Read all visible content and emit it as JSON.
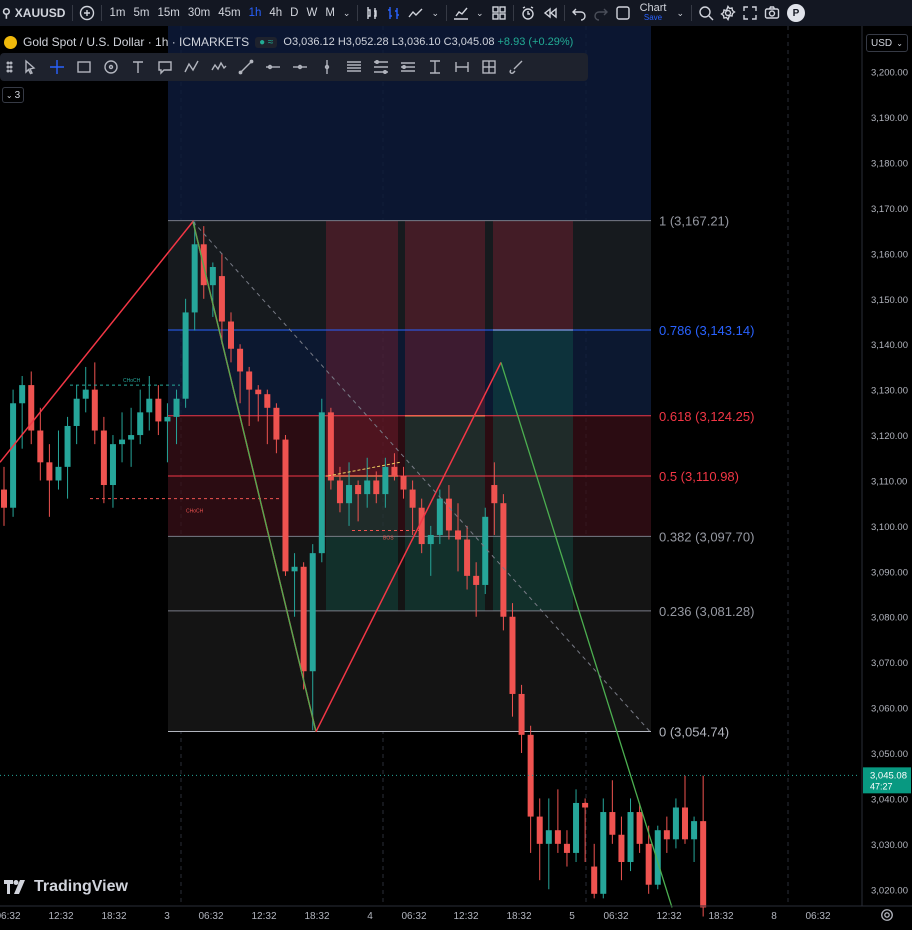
{
  "header": {
    "symbol": "XAUUSD",
    "timeframes": [
      "1m",
      "5m",
      "15m",
      "30m",
      "45m",
      "1h",
      "4h",
      "D",
      "W",
      "M"
    ],
    "active_timeframe": "1h",
    "chart_label": "Chart",
    "save_label": "Save",
    "avatar_letter": "P"
  },
  "legend": {
    "title": "Gold Spot / U.S. Dollar · 1h · ICMARKETS",
    "dots": "≈",
    "open": "O3,036.12",
    "high": "H3,052.28",
    "low": "L3,036.10",
    "close": "C3,045.08",
    "change": "+8.93 (+0.29%)"
  },
  "indicator_count": "3",
  "currency": "USD",
  "brand": "TradingView",
  "colors": {
    "up": "#26a69a",
    "down": "#ef5350",
    "background": "#000000",
    "fib_blue": "#2962ff",
    "fib_red": "#f23645"
  },
  "chart_data": {
    "type": "line",
    "y_axis": {
      "ticks": [
        "3,020.00",
        "3,030.00",
        "3,040.00",
        "3,050.00",
        "3,060.00",
        "3,070.00",
        "3,080.00",
        "3,090.00",
        "3,100.00",
        "3,110.00",
        "3,120.00",
        "3,130.00",
        "3,140.00",
        "3,150.00",
        "3,160.00",
        "3,170.00",
        "3,180.00",
        "3,190.00",
        "3,200.00"
      ],
      "range": [
        3016,
        3210
      ]
    },
    "x_axis": {
      "ticks": [
        "06:32",
        "12:32",
        "18:32",
        "3",
        "06:32",
        "12:32",
        "18:32",
        "4",
        "06:32",
        "12:32",
        "18:32",
        "5",
        "06:32",
        "12:32",
        "18:32",
        "8",
        "06:32"
      ]
    },
    "last_price": {
      "value": "3,045.08",
      "countdown": "47:27"
    },
    "fib_levels": [
      {
        "ratio": "1",
        "price": "3,167.21",
        "label": "1 (3,167.21)"
      },
      {
        "ratio": "0.786",
        "price": "3,143.14",
        "label": "0.786 (3,143.14)"
      },
      {
        "ratio": "0.618",
        "price": "3,124.25",
        "label": "0.618 (3,124.25)"
      },
      {
        "ratio": "0.5",
        "price": "3,110.98",
        "label": "0.5 (3,110.98)"
      },
      {
        "ratio": "0.382",
        "price": "3,097.70",
        "label": "0.382 (3,097.70)"
      },
      {
        "ratio": "0.236",
        "price": "3,081.28",
        "label": "0.236 (3,081.28)"
      },
      {
        "ratio": "0",
        "price": "3,054.74",
        "label": "0 (3,054.74)"
      }
    ],
    "annotations": [
      "CHoCH",
      "CHoCH",
      "BOS"
    ],
    "candles": [
      {
        "o": 3108,
        "h": 3113,
        "l": 3100,
        "c": 3104
      },
      {
        "o": 3104,
        "h": 3130,
        "l": 3102,
        "c": 3127
      },
      {
        "o": 3127,
        "h": 3133,
        "l": 3117,
        "c": 3131
      },
      {
        "o": 3131,
        "h": 3134,
        "l": 3118,
        "c": 3121
      },
      {
        "o": 3121,
        "h": 3126,
        "l": 3110,
        "c": 3114
      },
      {
        "o": 3114,
        "h": 3118,
        "l": 3102,
        "c": 3110
      },
      {
        "o": 3110,
        "h": 3121,
        "l": 3108,
        "c": 3113
      },
      {
        "o": 3113,
        "h": 3124,
        "l": 3106,
        "c": 3122
      },
      {
        "o": 3122,
        "h": 3131,
        "l": 3118,
        "c": 3128
      },
      {
        "o": 3128,
        "h": 3135,
        "l": 3125,
        "c": 3130
      },
      {
        "o": 3130,
        "h": 3136,
        "l": 3118,
        "c": 3121
      },
      {
        "o": 3121,
        "h": 3124,
        "l": 3105,
        "c": 3109
      },
      {
        "o": 3109,
        "h": 3120,
        "l": 3104,
        "c": 3118
      },
      {
        "o": 3118,
        "h": 3125,
        "l": 3114,
        "c": 3119
      },
      {
        "o": 3119,
        "h": 3126,
        "l": 3113,
        "c": 3120
      },
      {
        "o": 3120,
        "h": 3130,
        "l": 3118,
        "c": 3125
      },
      {
        "o": 3125,
        "h": 3133,
        "l": 3121,
        "c": 3128
      },
      {
        "o": 3128,
        "h": 3131,
        "l": 3120,
        "c": 3123
      },
      {
        "o": 3123,
        "h": 3127,
        "l": 3114,
        "c": 3124
      },
      {
        "o": 3124,
        "h": 3130,
        "l": 3118,
        "c": 3128
      },
      {
        "o": 3128,
        "h": 3150,
        "l": 3126,
        "c": 3147
      },
      {
        "o": 3147,
        "h": 3167,
        "l": 3143,
        "c": 3162
      },
      {
        "o": 3162,
        "h": 3166,
        "l": 3150,
        "c": 3153
      },
      {
        "o": 3153,
        "h": 3158,
        "l": 3146,
        "c": 3157
      },
      {
        "o": 3155,
        "h": 3160,
        "l": 3140,
        "c": 3145
      },
      {
        "o": 3145,
        "h": 3147,
        "l": 3136,
        "c": 3139
      },
      {
        "o": 3139,
        "h": 3140,
        "l": 3127,
        "c": 3134
      },
      {
        "o": 3134,
        "h": 3135,
        "l": 3122,
        "c": 3130
      },
      {
        "o": 3130,
        "h": 3131,
        "l": 3123,
        "c": 3129
      },
      {
        "o": 3129,
        "h": 3130,
        "l": 3118,
        "c": 3126
      },
      {
        "o": 3126,
        "h": 3127,
        "l": 3116,
        "c": 3119
      },
      {
        "o": 3119,
        "h": 3120,
        "l": 3089,
        "c": 3090
      },
      {
        "o": 3090,
        "h": 3094,
        "l": 3080,
        "c": 3091
      },
      {
        "o": 3091,
        "h": 3092,
        "l": 3064,
        "c": 3068
      },
      {
        "o": 3068,
        "h": 3096,
        "l": 3055,
        "c": 3094
      },
      {
        "o": 3094,
        "h": 3128,
        "l": 3092,
        "c": 3125
      },
      {
        "o": 3125,
        "h": 3126,
        "l": 3108,
        "c": 3110
      },
      {
        "o": 3110,
        "h": 3113,
        "l": 3103,
        "c": 3105
      },
      {
        "o": 3105,
        "h": 3114,
        "l": 3100,
        "c": 3109
      },
      {
        "o": 3109,
        "h": 3110,
        "l": 3101,
        "c": 3107
      },
      {
        "o": 3107,
        "h": 3115,
        "l": 3104,
        "c": 3110
      },
      {
        "o": 3110,
        "h": 3112,
        "l": 3105,
        "c": 3107
      },
      {
        "o": 3107,
        "h": 3115,
        "l": 3104,
        "c": 3113
      },
      {
        "o": 3113,
        "h": 3116,
        "l": 3110,
        "c": 3111
      },
      {
        "o": 3111,
        "h": 3113,
        "l": 3106,
        "c": 3108
      },
      {
        "o": 3108,
        "h": 3110,
        "l": 3098,
        "c": 3104
      },
      {
        "o": 3104,
        "h": 3106,
        "l": 3094,
        "c": 3096
      },
      {
        "o": 3096,
        "h": 3100,
        "l": 3089,
        "c": 3098
      },
      {
        "o": 3098,
        "h": 3108,
        "l": 3096,
        "c": 3106
      },
      {
        "o": 3106,
        "h": 3109,
        "l": 3097,
        "c": 3099
      },
      {
        "o": 3099,
        "h": 3105,
        "l": 3090,
        "c": 3097
      },
      {
        "o": 3097,
        "h": 3100,
        "l": 3086,
        "c": 3089
      },
      {
        "o": 3089,
        "h": 3092,
        "l": 3080,
        "c": 3087
      },
      {
        "o": 3087,
        "h": 3104,
        "l": 3085,
        "c": 3102
      },
      {
        "o": 3109,
        "h": 3114,
        "l": 3098,
        "c": 3105
      },
      {
        "o": 3105,
        "h": 3107,
        "l": 3077,
        "c": 3080
      },
      {
        "o": 3080,
        "h": 3083,
        "l": 3058,
        "c": 3063
      },
      {
        "o": 3063,
        "h": 3065,
        "l": 3050,
        "c": 3054
      },
      {
        "o": 3054,
        "h": 3056,
        "l": 3028,
        "c": 3036
      },
      {
        "o": 3036,
        "h": 3040,
        "l": 3022,
        "c": 3030
      },
      {
        "o": 3030,
        "h": 3040,
        "l": 3020,
        "c": 3033
      },
      {
        "o": 3033,
        "h": 3042,
        "l": 3028,
        "c": 3030
      },
      {
        "o": 3030,
        "h": 3033,
        "l": 3025,
        "c": 3028
      },
      {
        "o": 3028,
        "h": 3042,
        "l": 3026,
        "c": 3039
      },
      {
        "o": 3039,
        "h": 3040,
        "l": 3026,
        "c": 3038
      },
      {
        "o": 3025,
        "h": 3030,
        "l": 3018,
        "c": 3019
      },
      {
        "o": 3019,
        "h": 3040,
        "l": 3018,
        "c": 3037
      },
      {
        "o": 3037,
        "h": 3044,
        "l": 3030,
        "c": 3032
      },
      {
        "o": 3032,
        "h": 3036,
        "l": 3022,
        "c": 3026
      },
      {
        "o": 3026,
        "h": 3040,
        "l": 3024,
        "c": 3037
      },
      {
        "o": 3037,
        "h": 3039,
        "l": 3028,
        "c": 3030
      },
      {
        "o": 3030,
        "h": 3034,
        "l": 3019,
        "c": 3021
      },
      {
        "o": 3021,
        "h": 3034,
        "l": 3020,
        "c": 3033
      },
      {
        "o": 3033,
        "h": 3036,
        "l": 3028,
        "c": 3031
      },
      {
        "o": 3031,
        "h": 3040,
        "l": 3029,
        "c": 3038
      },
      {
        "o": 3038,
        "h": 3045,
        "l": 3030,
        "c": 3031
      },
      {
        "o": 3031,
        "h": 3036,
        "l": 3026,
        "c": 3035
      },
      {
        "o": 3035,
        "h": 3045,
        "l": 3014,
        "c": 3016
      }
    ]
  }
}
